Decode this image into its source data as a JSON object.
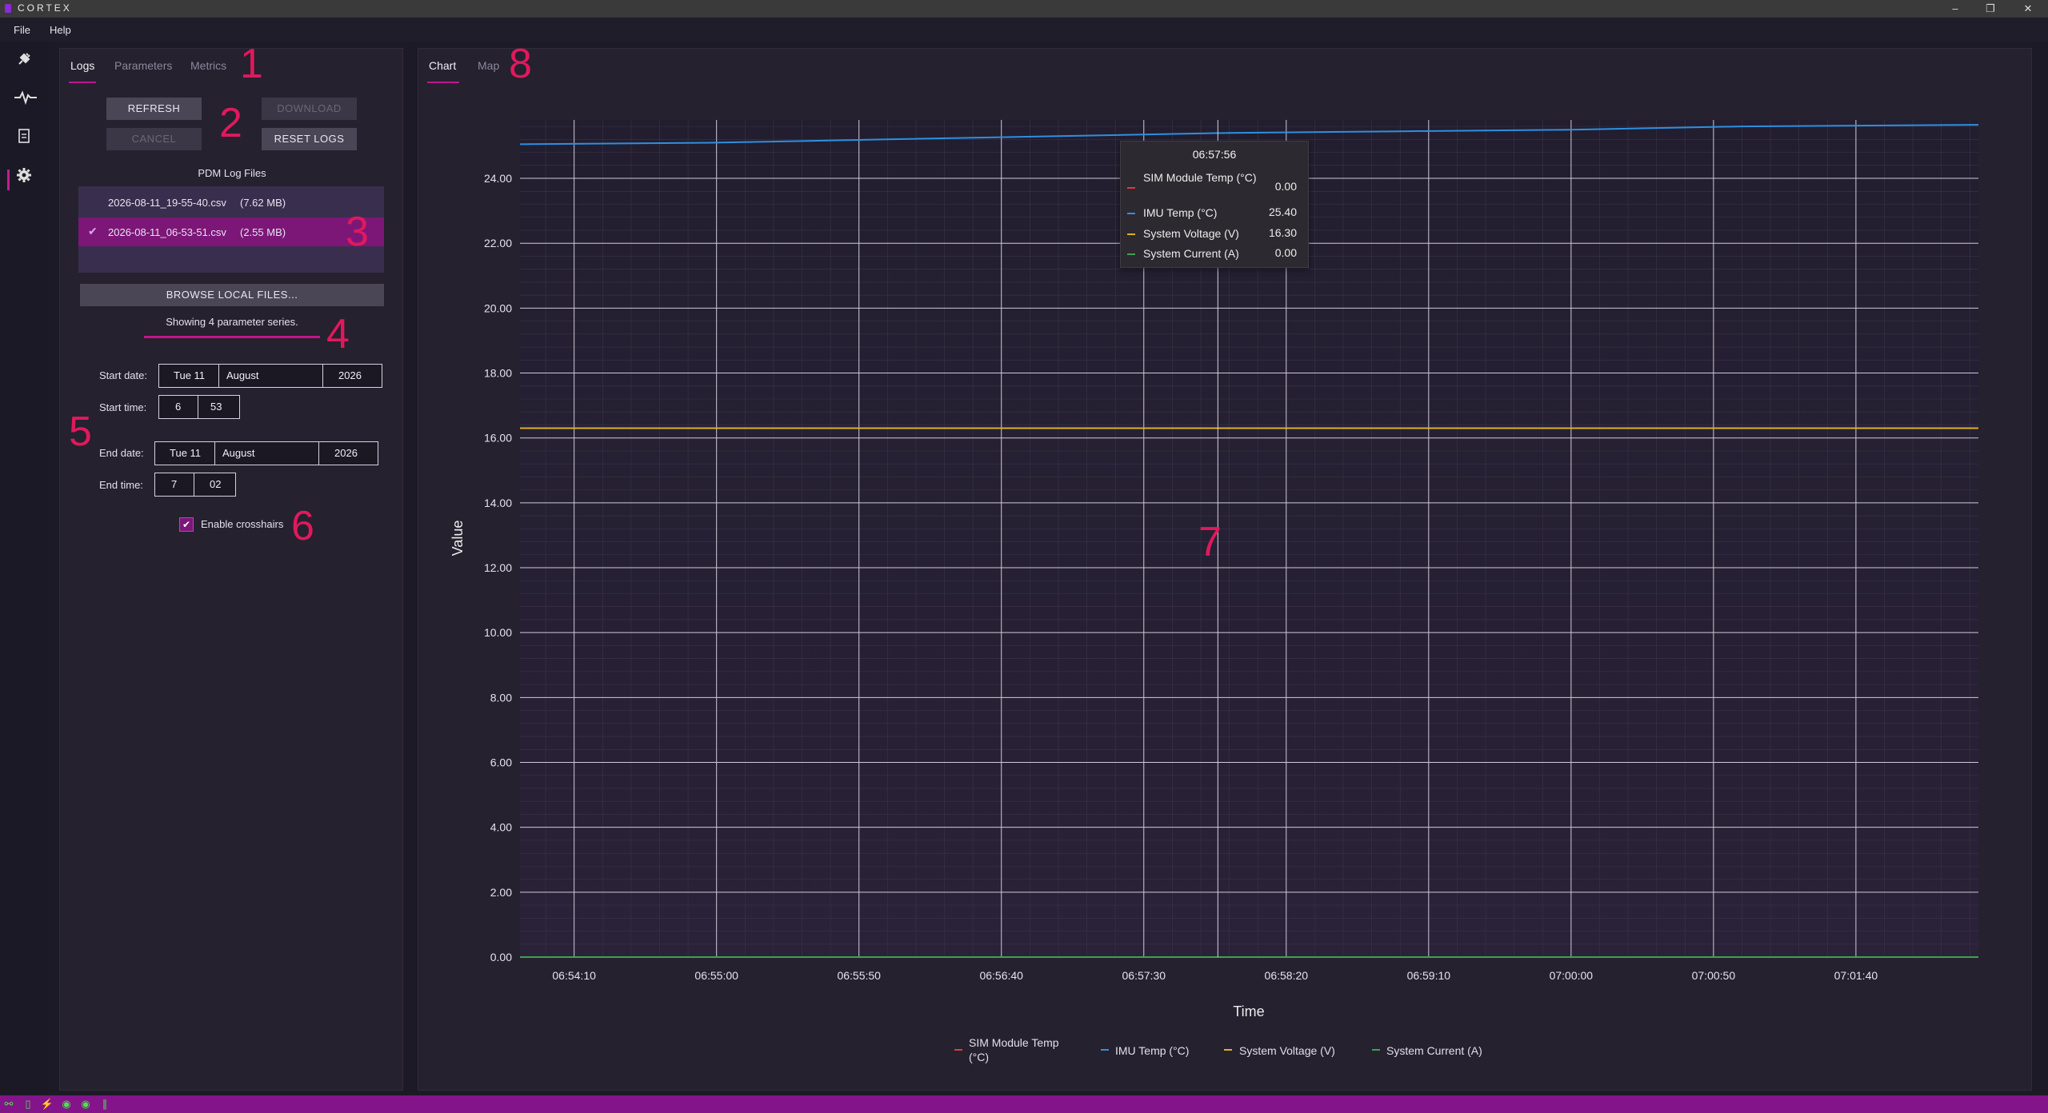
{
  "app": {
    "title": "CORTEX",
    "window_controls": [
      "–",
      "❐",
      "✕"
    ]
  },
  "menu": [
    "File",
    "Help"
  ],
  "sidebar": {
    "icons": [
      "plug-icon",
      "pulse-icon",
      "logs-icon",
      "gear-icon"
    ]
  },
  "left_tabs": [
    "Logs",
    "Parameters",
    "Metrics"
  ],
  "buttons": {
    "refresh": "REFRESH",
    "download": "DOWNLOAD",
    "cancel": "CANCEL",
    "reset_logs": "RESET LOGS",
    "browse": "BROWSE LOCAL FILES..."
  },
  "files_label": "PDM Log Files",
  "files": [
    {
      "name": "2026-08-11_19-55-40.csv",
      "size": "(7.62 MB)",
      "selected": false
    },
    {
      "name": "2026-08-11_06-53-51.csv",
      "size": "(2.55 MB)",
      "selected": true
    }
  ],
  "status_text": "Showing 4 parameter series.",
  "form": {
    "start_date_label": "Start date:",
    "start_date": {
      "day": "Tue 11",
      "month": "August",
      "year": "2026"
    },
    "start_time_label": "Start time:",
    "start_time": {
      "hour": "6",
      "minute": "53"
    },
    "end_date_label": "End date:",
    "end_date": {
      "day": "Tue 11",
      "month": "August",
      "year": "2026"
    },
    "end_time_label": "End time:",
    "end_time": {
      "hour": "7",
      "minute": "02"
    },
    "crosshairs_label": "Enable crosshairs",
    "crosshairs_checked": true
  },
  "right_tabs": [
    "Chart",
    "Map"
  ],
  "annotations": [
    "1",
    "2",
    "3",
    "4",
    "5",
    "6",
    "7",
    "8"
  ],
  "tooltip": {
    "time": "06:57:56",
    "rows": [
      {
        "label": "SIM Module Temp (°C)",
        "value": "0.00",
        "color": "#e23b3b"
      },
      {
        "label": "IMU Temp (°C)",
        "value": "25.40",
        "color": "#2e8fe0"
      },
      {
        "label": "System Voltage (V)",
        "value": "16.30",
        "color": "#e0b020"
      },
      {
        "label": "System Current (A)",
        "value": "0.00",
        "color": "#3fa34d"
      }
    ]
  },
  "chart_data": {
    "type": "line",
    "xlabel": "Time",
    "ylabel": "Value",
    "x_ticks": [
      "06:54:10",
      "06:55:00",
      "06:55:50",
      "06:56:40",
      "06:57:30",
      "06:58:20",
      "06:59:10",
      "07:00:00",
      "07:00:50",
      "07:01:40"
    ],
    "x_range": [
      "06:53:51",
      "07:02:23"
    ],
    "ylim": [
      0,
      25.8
    ],
    "y_ticks": [
      "0.00",
      "2.00",
      "4.00",
      "6.00",
      "8.00",
      "10.00",
      "12.00",
      "14.00",
      "16.00",
      "18.00",
      "20.00",
      "22.00",
      "24.00"
    ],
    "grid": true,
    "crosshair_x": "06:57:56",
    "legend_position": "bottom",
    "series": [
      {
        "name": "SIM Module Temp (°C)",
        "color": "#e23b3b",
        "x": [
          "06:53:51",
          "07:02:23"
        ],
        "values": [
          0.0,
          0.0
        ]
      },
      {
        "name": "IMU Temp (°C)",
        "color": "#2e8fe0",
        "x": [
          "06:53:51",
          "06:55:00",
          "06:56:00",
          "06:57:00",
          "06:58:00",
          "06:59:00",
          "07:00:00",
          "07:01:00",
          "07:02:23"
        ],
        "values": [
          25.05,
          25.1,
          25.2,
          25.3,
          25.4,
          25.45,
          25.5,
          25.6,
          25.65
        ]
      },
      {
        "name": "System Voltage (V)",
        "color": "#e0b020",
        "x": [
          "06:53:51",
          "07:02:23"
        ],
        "values": [
          16.3,
          16.3
        ]
      },
      {
        "name": "System Current (A)",
        "color": "#3fa34d",
        "x": [
          "06:53:51",
          "07:02:23"
        ],
        "values": [
          0.0,
          0.0
        ]
      }
    ]
  }
}
